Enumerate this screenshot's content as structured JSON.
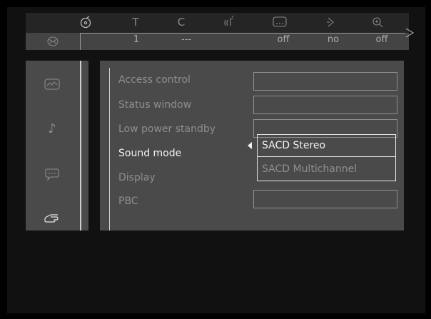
{
  "status_bar": {
    "icons": [
      {
        "name": "title-icon",
        "glyph": "T"
      },
      {
        "name": "chapter-icon",
        "glyph": "C"
      },
      {
        "name": "audio-icon"
      },
      {
        "name": "subtitle-icon"
      },
      {
        "name": "angle-icon"
      },
      {
        "name": "zoom-icon"
      }
    ],
    "values": {
      "disc": "1",
      "title": "---",
      "subtitle": "off",
      "angle": "no",
      "zoom": "off"
    }
  },
  "side_menu": {
    "items": [
      {
        "name": "picture-settings-icon"
      },
      {
        "name": "sound-settings-icon"
      },
      {
        "name": "language-settings-icon"
      },
      {
        "name": "features-icon",
        "selected": true
      }
    ]
  },
  "settings": {
    "rows": [
      {
        "label": "Access control"
      },
      {
        "label": "Status window"
      },
      {
        "label": "Low power standby"
      },
      {
        "label": "Sound mode",
        "active": true
      },
      {
        "label": "Display"
      },
      {
        "label": "PBC"
      }
    ],
    "sound_mode_options": [
      "SACD Stereo",
      "SACD Multichannel"
    ],
    "sound_mode_selected": "SACD Stereo"
  },
  "colors": {
    "background": "#000000",
    "panel": "#4a4a4a",
    "highlight_text": "#f2f2f2",
    "dim_text": "#8e8e8e"
  }
}
